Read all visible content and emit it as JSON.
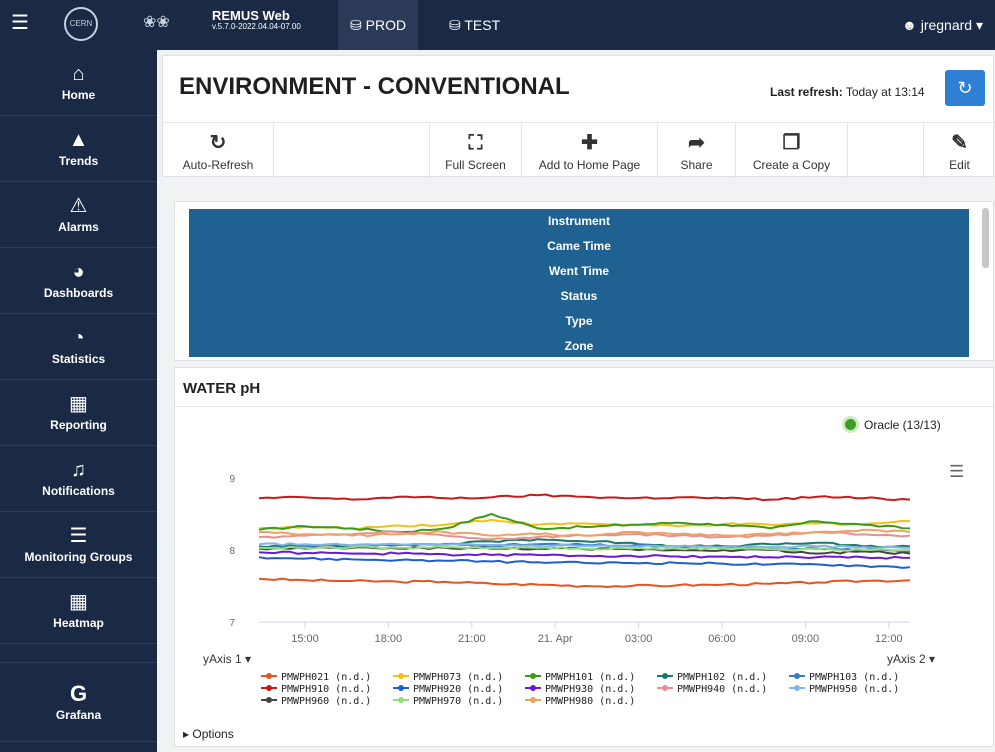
{
  "topbar": {
    "app_name": "REMUS Web",
    "version": "v.5.7.0-2022.04.04-07.00",
    "logo_text": "CERN",
    "env_prod": "PROD",
    "env_test": "TEST",
    "user": "jregnard"
  },
  "sidebar": {
    "items": [
      {
        "label": "Home",
        "icon": "home-icon"
      },
      {
        "label": "Trends",
        "icon": "area-chart-icon"
      },
      {
        "label": "Alarms",
        "icon": "warning-icon"
      },
      {
        "label": "Dashboards",
        "icon": "dashboard-icon"
      },
      {
        "label": "Statistics",
        "icon": "pie-chart-icon"
      },
      {
        "label": "Reporting",
        "icon": "file-icon"
      },
      {
        "label": "Notifications",
        "icon": "bell-icon"
      },
      {
        "label": "Monitoring Groups",
        "icon": "list-icon"
      },
      {
        "label": "Heatmap",
        "icon": "grid-icon"
      },
      {
        "label": "Grafana",
        "icon": "grafana-icon"
      }
    ]
  },
  "page": {
    "title": "ENVIRONMENT - CONVENTIONAL",
    "last_refresh_label": "Last refresh:",
    "last_refresh_value": "Today at 13:14"
  },
  "toolbar": {
    "auto_refresh": "Auto-Refresh",
    "full_screen": "Full Screen",
    "add_home": "Add to Home Page",
    "share": "Share",
    "copy": "Create a Copy",
    "edit": "Edit"
  },
  "events_table": {
    "columns": [
      "Instrument",
      "Came Time",
      "Went Time",
      "Status",
      "Type",
      "Zone"
    ]
  },
  "chart": {
    "title": "WATER pH",
    "status": "Oracle (13/13)",
    "yaxis1": "yAxis 1",
    "yaxis2": "yAxis 2",
    "options_label": "Options"
  },
  "chart_data": {
    "type": "line",
    "title": "WATER pH",
    "xlabel": "",
    "ylabel": "",
    "x_ticks": [
      "15:00",
      "18:00",
      "21:00",
      "21. Apr",
      "03:00",
      "06:00",
      "09:00",
      "12:00"
    ],
    "y_ticks": [
      7,
      8,
      9
    ],
    "ylim": [
      7,
      9
    ],
    "legend_position": "bottom",
    "grid": false,
    "series": [
      {
        "name": "PMWPH021 (n.d.)",
        "color": "#e8531c",
        "values": [
          7.6,
          7.58,
          7.57,
          7.56,
          7.56,
          7.53,
          7.52,
          7.5,
          7.5,
          7.51,
          7.52,
          7.53,
          7.55,
          7.57,
          7.58
        ]
      },
      {
        "name": "PMWPH073 (n.d.)",
        "color": "#f5c011",
        "values": [
          8.3,
          8.32,
          8.3,
          8.34,
          8.35,
          8.42,
          8.35,
          8.37,
          8.35,
          8.33,
          8.36,
          8.35,
          8.37,
          8.36,
          8.4
        ]
      },
      {
        "name": "PMWPH101 (n.d.)",
        "color": "#3a9a1a",
        "values": [
          8.28,
          8.33,
          8.3,
          8.25,
          8.3,
          8.5,
          8.3,
          8.32,
          8.35,
          8.38,
          8.35,
          8.3,
          8.4,
          8.35,
          8.3
        ]
      },
      {
        "name": "PMWPH102 (n.d.)",
        "color": "#1a7a6a",
        "values": [
          8.05,
          8.05,
          8.06,
          8.07,
          8.08,
          8.12,
          8.15,
          8.12,
          8.1,
          8.05,
          8.05,
          8.08,
          8.1,
          8.05,
          8.05
        ]
      },
      {
        "name": "PMWPH103 (n.d.)",
        "color": "#3a78c8",
        "values": [
          8.02,
          8.05,
          8.06,
          8.07,
          8.08,
          8.06,
          8.08,
          8.07,
          8.06,
          8.05,
          8.04,
          8.03,
          8.02,
          8.0,
          7.98
        ]
      },
      {
        "name": "PMWPH910 (n.d.)",
        "color": "#c81818",
        "values": [
          8.72,
          8.73,
          8.7,
          8.74,
          8.72,
          8.73,
          8.76,
          8.74,
          8.72,
          8.73,
          8.72,
          8.7,
          8.74,
          8.72,
          8.7
        ]
      },
      {
        "name": "PMWPH920 (n.d.)",
        "color": "#1d5fcf",
        "values": [
          7.9,
          7.88,
          7.87,
          7.86,
          7.85,
          7.84,
          7.83,
          7.82,
          7.82,
          7.82,
          7.81,
          7.8,
          7.8,
          7.78,
          7.76
        ]
      },
      {
        "name": "PMWPH930 (n.d.)",
        "color": "#6a18d8",
        "values": [
          7.97,
          7.96,
          7.95,
          7.95,
          7.94,
          7.93,
          7.93,
          7.92,
          7.92,
          7.91,
          7.91,
          7.9,
          7.9,
          7.9,
          7.89
        ]
      },
      {
        "name": "PMWPH940 (n.d.)",
        "color": "#e89090",
        "values": [
          8.18,
          8.2,
          8.22,
          8.25,
          8.2,
          8.15,
          8.18,
          8.2,
          8.22,
          8.2,
          8.18,
          8.2,
          8.25,
          8.22,
          8.2
        ]
      },
      {
        "name": "PMWPH950 (n.d.)",
        "color": "#86b4e8",
        "values": [
          8.08,
          8.08,
          8.07,
          8.08,
          8.07,
          8.07,
          8.06,
          8.06,
          8.05,
          8.05,
          8.04,
          8.04,
          8.05,
          8.04,
          8.03
        ]
      },
      {
        "name": "PMWPH960 (n.d.)",
        "color": "#444444",
        "values": [
          8.02,
          8.02,
          8.03,
          8.02,
          8.03,
          8.02,
          8.02,
          8.01,
          8.01,
          8.0,
          8.0,
          8.0,
          7.95,
          7.98,
          7.95
        ]
      },
      {
        "name": "PMWPH970 (n.d.)",
        "color": "#8fe07a",
        "values": [
          8.03,
          8.03,
          8.04,
          8.03,
          8.04,
          8.03,
          8.03,
          8.02,
          8.02,
          8.02,
          8.02,
          8.01,
          8.01,
          8.0,
          8.0
        ]
      },
      {
        "name": "PMWPH980 (n.d.)",
        "color": "#f0a060",
        "values": [
          8.25,
          8.22,
          8.2,
          8.22,
          8.25,
          8.2,
          8.22,
          8.2,
          8.25,
          8.22,
          8.2,
          8.22,
          8.25,
          8.28,
          8.25
        ]
      }
    ]
  }
}
